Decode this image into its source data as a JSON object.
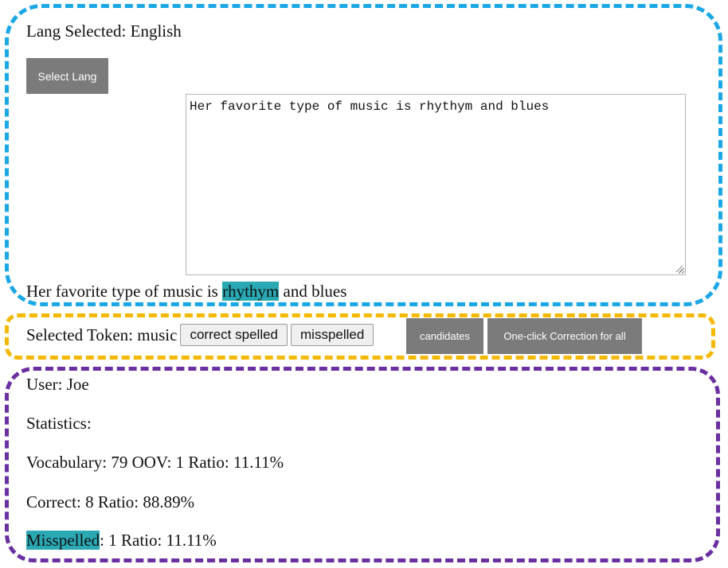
{
  "colors": {
    "top_frame": "#1aa7e6",
    "middle_frame": "#f5b800",
    "bottom_frame": "#6a2fa0",
    "highlight": "#2aa9b4",
    "gray_button": "#7b7b7b"
  },
  "language": {
    "label": "Lang Selected:",
    "value": "English",
    "select_button": "Select Lang"
  },
  "editor": {
    "text": "Her favorite type of music is rhythym and blues"
  },
  "tokenized": {
    "before": "Her favorite type of music is ",
    "flagged": "rhythym",
    "after": " and blues"
  },
  "token_panel": {
    "label": "Selected Token:",
    "token": "music",
    "correct_button": "correct spelled",
    "misspelled_button": "misspelled",
    "candidates_button": "candidates",
    "one_click_button": "One-click Correction for all"
  },
  "stats": {
    "user_label": "User:",
    "user": "Joe",
    "heading": "Statistics:",
    "vocabulary_label": "Vocabulary:",
    "vocabulary": "79",
    "oov_label": "OOV:",
    "oov": "1",
    "oov_ratio_label": "Ratio:",
    "oov_ratio": "11.11%",
    "correct_label": "Correct:",
    "correct": "8",
    "correct_ratio_label": "Ratio:",
    "correct_ratio": "88.89%",
    "misspelled_label": "Misspelled",
    "misspelled": "1",
    "misspelled_ratio_label": "Ratio:",
    "misspelled_ratio": "11.11%"
  }
}
